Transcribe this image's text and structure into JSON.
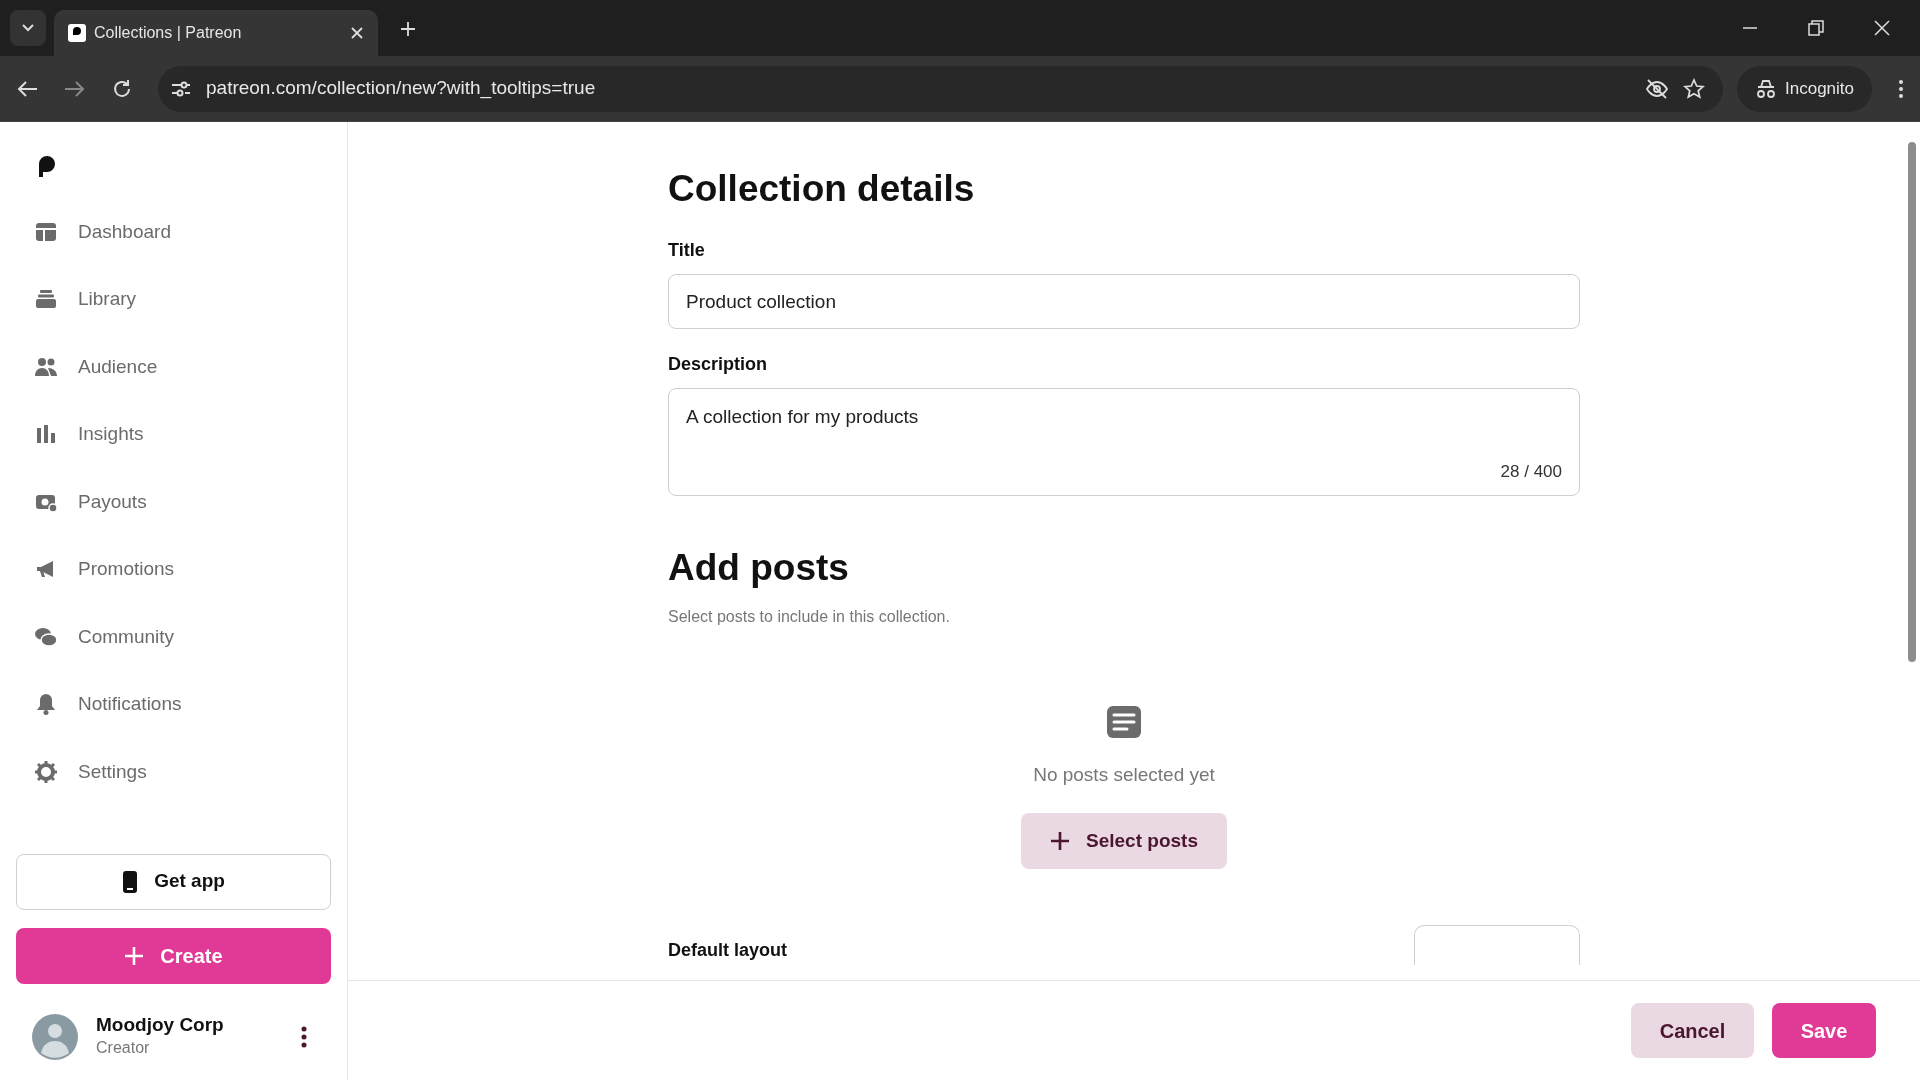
{
  "browser": {
    "tab_title": "Collections | Patreon",
    "url": "patreon.com/collection/new?with_tooltips=true",
    "profile_label": "Incognito"
  },
  "sidebar": {
    "items": [
      {
        "label": "Dashboard"
      },
      {
        "label": "Library"
      },
      {
        "label": "Audience"
      },
      {
        "label": "Insights"
      },
      {
        "label": "Payouts"
      },
      {
        "label": "Promotions"
      },
      {
        "label": "Community"
      },
      {
        "label": "Notifications"
      },
      {
        "label": "Settings"
      }
    ],
    "get_app_button": "Get app",
    "create_button": "Create",
    "user": {
      "name": "Moodjoy Corp",
      "role": "Creator"
    }
  },
  "form": {
    "heading": "Collection details",
    "title_label": "Title",
    "title_value": "Product collection",
    "description_label": "Description",
    "description_value": "A collection for my products",
    "char_count": "28 / 400",
    "posts_heading": "Add posts",
    "posts_subtitle": "Select posts to include in this collection.",
    "empty_text": "No posts selected yet",
    "select_button": "Select posts",
    "layout_label": "Default layout"
  },
  "footer": {
    "cancel_button": "Cancel",
    "save_button": "Save"
  }
}
